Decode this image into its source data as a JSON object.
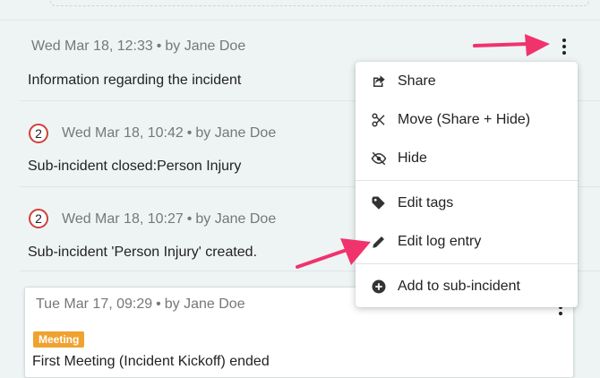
{
  "entries": [
    {
      "meta": "Wed Mar 18, 12:33",
      "author": "by Jane Doe",
      "text": "Information regarding the incident"
    },
    {
      "badge": "2",
      "meta": "Wed Mar 18, 10:42",
      "author": "by Jane Doe",
      "text": "Sub-incident closed:Person Injury"
    },
    {
      "badge": "2",
      "meta": "Wed Mar 18, 10:27",
      "author": "by Jane Doe",
      "text": "Sub-incident 'Person Injury' created."
    }
  ],
  "card": {
    "meta": "Tue Mar 17, 09:29",
    "author": "by Jane Doe",
    "tag": "Meeting",
    "text": "First Meeting (Incident Kickoff) ended"
  },
  "menu": {
    "items": [
      {
        "label": "Share",
        "icon": "share-icon"
      },
      {
        "label": "Move (Share + Hide)",
        "icon": "scissors-icon"
      },
      {
        "label": "Hide",
        "icon": "eye-off-icon"
      },
      {
        "label": "Edit tags",
        "icon": "tag-icon"
      },
      {
        "label": "Edit log entry",
        "icon": "pencil-icon"
      },
      {
        "label": "Add to sub-incident",
        "icon": "plus-circle-icon"
      }
    ]
  },
  "colors": {
    "accent_arrow": "#f0336d",
    "badge_ring": "#d0413a",
    "tag_bg": "#f0a230",
    "background": "#eef4f4"
  }
}
